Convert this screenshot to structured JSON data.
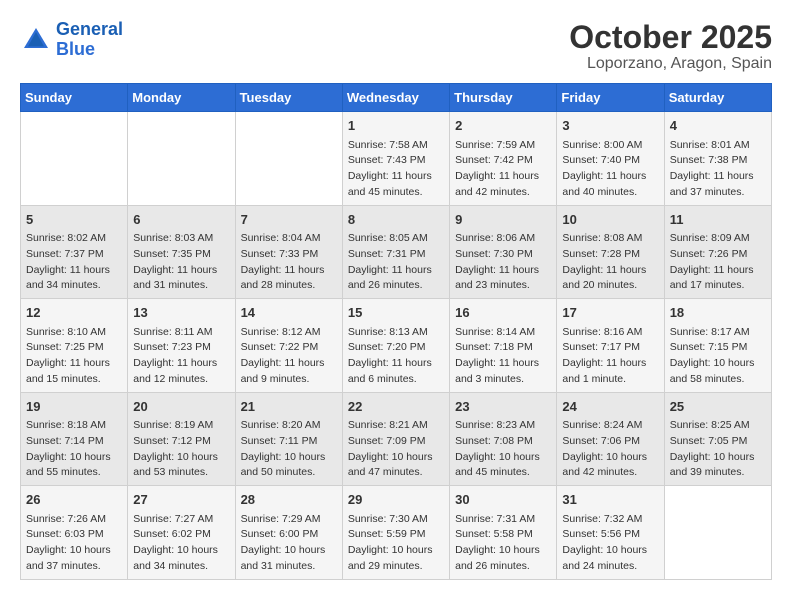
{
  "logo": {
    "line1": "General",
    "line2": "Blue"
  },
  "title": "October 2025",
  "subtitle": "Loporzano, Aragon, Spain",
  "days_of_week": [
    "Sunday",
    "Monday",
    "Tuesday",
    "Wednesday",
    "Thursday",
    "Friday",
    "Saturday"
  ],
  "weeks": [
    [
      {
        "day": "",
        "sunrise": "",
        "sunset": "",
        "daylight": ""
      },
      {
        "day": "",
        "sunrise": "",
        "sunset": "",
        "daylight": ""
      },
      {
        "day": "",
        "sunrise": "",
        "sunset": "",
        "daylight": ""
      },
      {
        "day": "1",
        "sunrise": "Sunrise: 7:58 AM",
        "sunset": "Sunset: 7:43 PM",
        "daylight": "Daylight: 11 hours and 45 minutes."
      },
      {
        "day": "2",
        "sunrise": "Sunrise: 7:59 AM",
        "sunset": "Sunset: 7:42 PM",
        "daylight": "Daylight: 11 hours and 42 minutes."
      },
      {
        "day": "3",
        "sunrise": "Sunrise: 8:00 AM",
        "sunset": "Sunset: 7:40 PM",
        "daylight": "Daylight: 11 hours and 40 minutes."
      },
      {
        "day": "4",
        "sunrise": "Sunrise: 8:01 AM",
        "sunset": "Sunset: 7:38 PM",
        "daylight": "Daylight: 11 hours and 37 minutes."
      }
    ],
    [
      {
        "day": "5",
        "sunrise": "Sunrise: 8:02 AM",
        "sunset": "Sunset: 7:37 PM",
        "daylight": "Daylight: 11 hours and 34 minutes."
      },
      {
        "day": "6",
        "sunrise": "Sunrise: 8:03 AM",
        "sunset": "Sunset: 7:35 PM",
        "daylight": "Daylight: 11 hours and 31 minutes."
      },
      {
        "day": "7",
        "sunrise": "Sunrise: 8:04 AM",
        "sunset": "Sunset: 7:33 PM",
        "daylight": "Daylight: 11 hours and 28 minutes."
      },
      {
        "day": "8",
        "sunrise": "Sunrise: 8:05 AM",
        "sunset": "Sunset: 7:31 PM",
        "daylight": "Daylight: 11 hours and 26 minutes."
      },
      {
        "day": "9",
        "sunrise": "Sunrise: 8:06 AM",
        "sunset": "Sunset: 7:30 PM",
        "daylight": "Daylight: 11 hours and 23 minutes."
      },
      {
        "day": "10",
        "sunrise": "Sunrise: 8:08 AM",
        "sunset": "Sunset: 7:28 PM",
        "daylight": "Daylight: 11 hours and 20 minutes."
      },
      {
        "day": "11",
        "sunrise": "Sunrise: 8:09 AM",
        "sunset": "Sunset: 7:26 PM",
        "daylight": "Daylight: 11 hours and 17 minutes."
      }
    ],
    [
      {
        "day": "12",
        "sunrise": "Sunrise: 8:10 AM",
        "sunset": "Sunset: 7:25 PM",
        "daylight": "Daylight: 11 hours and 15 minutes."
      },
      {
        "day": "13",
        "sunrise": "Sunrise: 8:11 AM",
        "sunset": "Sunset: 7:23 PM",
        "daylight": "Daylight: 11 hours and 12 minutes."
      },
      {
        "day": "14",
        "sunrise": "Sunrise: 8:12 AM",
        "sunset": "Sunset: 7:22 PM",
        "daylight": "Daylight: 11 hours and 9 minutes."
      },
      {
        "day": "15",
        "sunrise": "Sunrise: 8:13 AM",
        "sunset": "Sunset: 7:20 PM",
        "daylight": "Daylight: 11 hours and 6 minutes."
      },
      {
        "day": "16",
        "sunrise": "Sunrise: 8:14 AM",
        "sunset": "Sunset: 7:18 PM",
        "daylight": "Daylight: 11 hours and 3 minutes."
      },
      {
        "day": "17",
        "sunrise": "Sunrise: 8:16 AM",
        "sunset": "Sunset: 7:17 PM",
        "daylight": "Daylight: 11 hours and 1 minute."
      },
      {
        "day": "18",
        "sunrise": "Sunrise: 8:17 AM",
        "sunset": "Sunset: 7:15 PM",
        "daylight": "Daylight: 10 hours and 58 minutes."
      }
    ],
    [
      {
        "day": "19",
        "sunrise": "Sunrise: 8:18 AM",
        "sunset": "Sunset: 7:14 PM",
        "daylight": "Daylight: 10 hours and 55 minutes."
      },
      {
        "day": "20",
        "sunrise": "Sunrise: 8:19 AM",
        "sunset": "Sunset: 7:12 PM",
        "daylight": "Daylight: 10 hours and 53 minutes."
      },
      {
        "day": "21",
        "sunrise": "Sunrise: 8:20 AM",
        "sunset": "Sunset: 7:11 PM",
        "daylight": "Daylight: 10 hours and 50 minutes."
      },
      {
        "day": "22",
        "sunrise": "Sunrise: 8:21 AM",
        "sunset": "Sunset: 7:09 PM",
        "daylight": "Daylight: 10 hours and 47 minutes."
      },
      {
        "day": "23",
        "sunrise": "Sunrise: 8:23 AM",
        "sunset": "Sunset: 7:08 PM",
        "daylight": "Daylight: 10 hours and 45 minutes."
      },
      {
        "day": "24",
        "sunrise": "Sunrise: 8:24 AM",
        "sunset": "Sunset: 7:06 PM",
        "daylight": "Daylight: 10 hours and 42 minutes."
      },
      {
        "day": "25",
        "sunrise": "Sunrise: 8:25 AM",
        "sunset": "Sunset: 7:05 PM",
        "daylight": "Daylight: 10 hours and 39 minutes."
      }
    ],
    [
      {
        "day": "26",
        "sunrise": "Sunrise: 7:26 AM",
        "sunset": "Sunset: 6:03 PM",
        "daylight": "Daylight: 10 hours and 37 minutes."
      },
      {
        "day": "27",
        "sunrise": "Sunrise: 7:27 AM",
        "sunset": "Sunset: 6:02 PM",
        "daylight": "Daylight: 10 hours and 34 minutes."
      },
      {
        "day": "28",
        "sunrise": "Sunrise: 7:29 AM",
        "sunset": "Sunset: 6:00 PM",
        "daylight": "Daylight: 10 hours and 31 minutes."
      },
      {
        "day": "29",
        "sunrise": "Sunrise: 7:30 AM",
        "sunset": "Sunset: 5:59 PM",
        "daylight": "Daylight: 10 hours and 29 minutes."
      },
      {
        "day": "30",
        "sunrise": "Sunrise: 7:31 AM",
        "sunset": "Sunset: 5:58 PM",
        "daylight": "Daylight: 10 hours and 26 minutes."
      },
      {
        "day": "31",
        "sunrise": "Sunrise: 7:32 AM",
        "sunset": "Sunset: 5:56 PM",
        "daylight": "Daylight: 10 hours and 24 minutes."
      },
      {
        "day": "",
        "sunrise": "",
        "sunset": "",
        "daylight": ""
      }
    ]
  ]
}
